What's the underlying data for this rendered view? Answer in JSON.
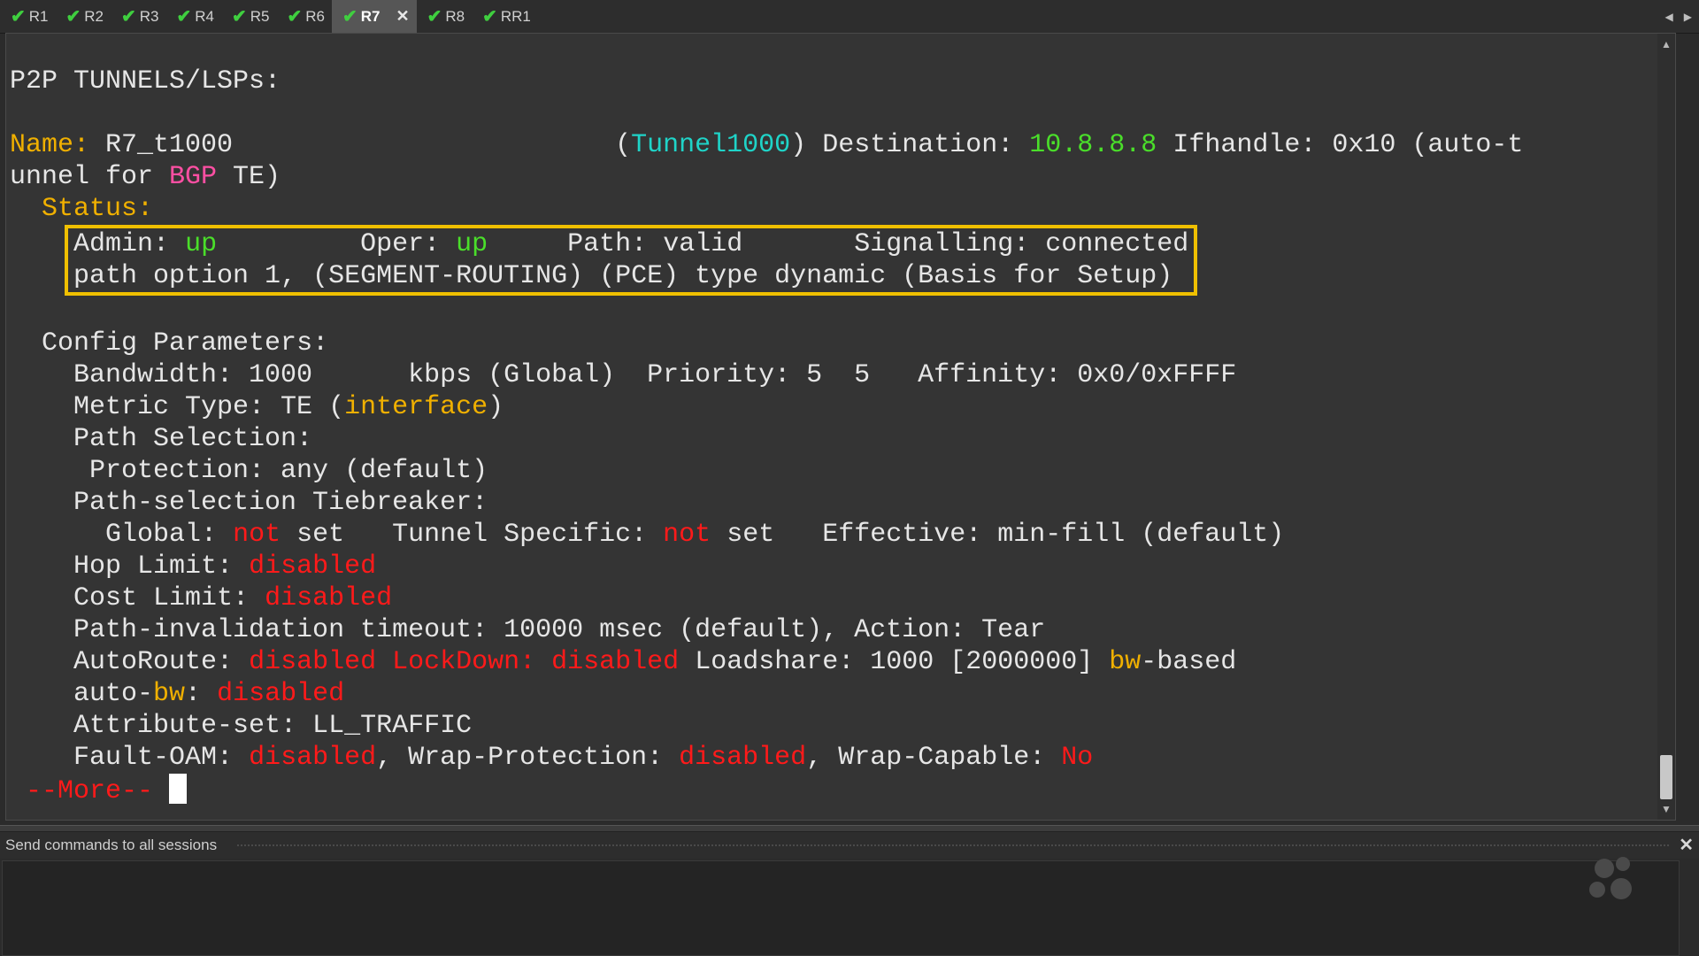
{
  "tabs": [
    {
      "label": "R1",
      "active": false
    },
    {
      "label": "R2",
      "active": false
    },
    {
      "label": "R3",
      "active": false
    },
    {
      "label": "R4",
      "active": false
    },
    {
      "label": "R5",
      "active": false
    },
    {
      "label": "R6",
      "active": false
    },
    {
      "label": "R7",
      "active": true
    },
    {
      "label": "R8",
      "active": false
    },
    {
      "label": "RR1",
      "active": false
    }
  ],
  "terminal": {
    "heading": "P2P TUNNELS/LSPs:",
    "name_label": "Name:",
    "name_value": "R7_t1000",
    "tunnel_paren_open": "(",
    "tunnel": "Tunnel1000",
    "tunnel_paren_close": ")",
    "destination_label": "Destination:",
    "destination": "10.8.8.8",
    "ifhandle": "Ifhandle: 0x10 (auto-t",
    "line2_a": "unnel for ",
    "line2_bgp": "BGP",
    "line2_b": " TE)",
    "status_label": "Status:",
    "admin_label": "Admin:",
    "admin_value": "up",
    "oper_label": "Oper:",
    "oper_value": "up",
    "path_status": "Path: valid",
    "signalling": "Signalling: connected",
    "path_option": "path option 1, (SEGMENT-ROUTING) (PCE) type dynamic (Basis for Setup)",
    "config_label": "Config Parameters:",
    "bandwidth": "Bandwidth: 1000      kbps (Global)  Priority: 5  5   Affinity: 0x0/0xFFFF",
    "metric_a": "Metric Type: TE (",
    "metric_interface": "interface",
    "metric_b": ")",
    "path_selection": "Path Selection:",
    "protection": "Protection: any (default)",
    "tiebreaker": "Path-selection Tiebreaker:",
    "global_label": "Global: ",
    "not_word": "not",
    "set_word": " set",
    "tunnel_specific": "Tunnel Specific: ",
    "effective": "Effective: min-fill (default)",
    "hop_limit": "Hop Limit: ",
    "cost_limit": "Cost Limit: ",
    "disabled_word": "disabled",
    "invalidation": "Path-invalidation timeout: 10000 msec (default), Action: Tear",
    "autoroute": "AutoRoute: ",
    "lockdown": "LockDown: ",
    "loadshare": "Loadshare: 1000 [2000000] ",
    "bw_word": "bw",
    "based_word": "-based",
    "auto_word": "auto-",
    "colon_space": ": ",
    "attribute_set": "Attribute-set: LL_TRAFFIC",
    "fault_oam": "Fault-OAM: ",
    "wrap_protection": ", Wrap-Protection: ",
    "wrap_capable": ", Wrap-Capable: ",
    "no_word": "No",
    "more": "--More--"
  },
  "send_bar": {
    "label": "Send commands to all sessions"
  },
  "colors": {
    "yellow": "#f0b000",
    "green": "#4ade2a",
    "cyan": "#1fd4c8",
    "pink": "#ff4fa3",
    "red": "#ff1a1a"
  }
}
